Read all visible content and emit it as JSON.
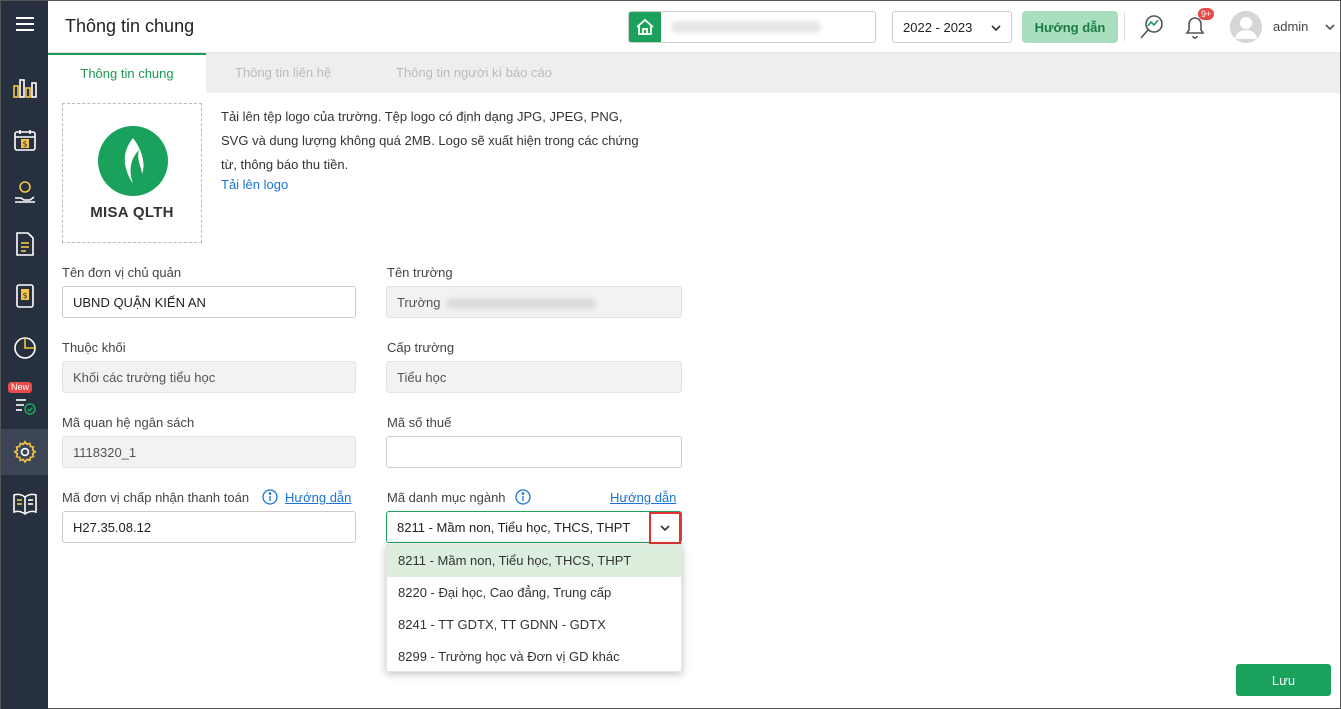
{
  "header": {
    "title": "Thông tin chung",
    "year": "2022 - 2023",
    "guide_label": "Hướng dẫn",
    "notification_badge": "9+",
    "username": "admin"
  },
  "tabs": [
    {
      "label": "Thông tin chung",
      "active": true
    },
    {
      "label": "Thông tin liên hệ",
      "active": false
    },
    {
      "label": "Thông tin người kí báo cáo",
      "active": false
    }
  ],
  "sidebar": {
    "new_badge": "New",
    "items": [
      "chart-bars-icon",
      "calendar-money-icon",
      "money-hand-icon",
      "document-icon",
      "money-book-icon",
      "pie-chart-icon",
      "checklist-new-icon",
      "gear-icon",
      "book-open-icon"
    ]
  },
  "logo": {
    "brand_text": "MISA QLTH",
    "description": "Tải lên tệp logo của trường. Tệp logo có định dạng JPG, JPEG, PNG, SVG và dung lượng không quá 2MB. Logo sẽ xuất hiện trong các chứng từ, thông báo thu tiền.",
    "upload_label": "Tải lên logo"
  },
  "form": {
    "don_vi_chu_quan": {
      "label": "Tên đơn vị chủ quản",
      "value": "UBND QUẬN KIẾN AN"
    },
    "ten_truong": {
      "label": "Tên trường",
      "value": "Trường"
    },
    "thuoc_khoi": {
      "label": "Thuộc khối",
      "value": "Khối các trường tiểu học"
    },
    "cap_truong": {
      "label": "Cấp trường",
      "value": "Tiểu học"
    },
    "ma_qhns": {
      "label": "Mã quan hệ ngân sách",
      "value": "1118320_1"
    },
    "ma_so_thue": {
      "label": "Mã số thuế",
      "value": ""
    },
    "ma_dv_thanh_toan": {
      "label": "Mã đơn vị chấp nhận thanh toán",
      "value": "H27.35.08.12",
      "guide": "Hướng dẫn"
    },
    "ma_danh_muc_nganh": {
      "label": "Mã danh mục ngành",
      "value": "8211 - Mầm non, Tiểu học, THCS, THPT",
      "guide": "Hướng dẫn"
    }
  },
  "dropdown_options": [
    "8211 - Mầm non, Tiểu học, THCS, THPT",
    "8220 - Đại học, Cao đẳng, Trung cấp",
    "8241 - TT GDTX, TT GDNN - GDTX",
    "8299 - Trường học và Đơn vị GD khác"
  ],
  "save_label": "Lưu",
  "colors": {
    "accent": "#1aa15b",
    "sidebar": "#27303f",
    "link": "#1a73d6",
    "highlight_border": "#e03434"
  }
}
